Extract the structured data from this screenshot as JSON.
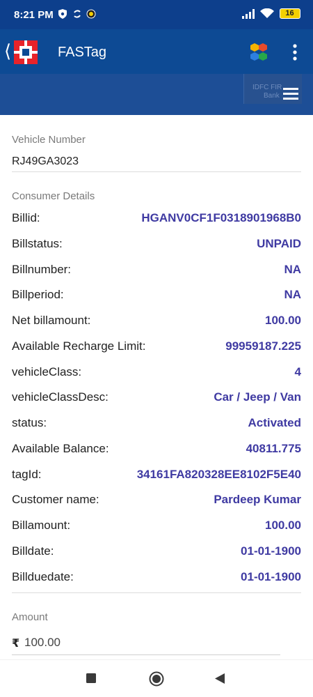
{
  "status_bar": {
    "time": "8:21 PM",
    "battery": "16"
  },
  "app_bar": {
    "title": "FASTag"
  },
  "banner": {
    "bank_text_line1": "IDFC FIR",
    "bank_text_line2": "Bank"
  },
  "vehicle": {
    "label": "Vehicle Number",
    "value": "RJ49GA3023"
  },
  "consumer": {
    "section_label": "Consumer Details",
    "rows": [
      {
        "key": "Billid:",
        "value": "HGANV0CF1F0318901968B0"
      },
      {
        "key": "Billstatus:",
        "value": "UNPAID"
      },
      {
        "key": "Billnumber:",
        "value": "NA"
      },
      {
        "key": "Billperiod:",
        "value": "NA"
      },
      {
        "key": "Net billamount:",
        "value": "100.00"
      },
      {
        "key": "Available Recharge Limit:",
        "value": "99959187.225"
      },
      {
        "key": "vehicleClass:",
        "value": "4"
      },
      {
        "key": "vehicleClassDesc:",
        "value": "Car / Jeep / Van"
      },
      {
        "key": "status:",
        "value": "Activated"
      },
      {
        "key": "Available Balance:",
        "value": "40811.775"
      },
      {
        "key": "tagId:",
        "value": "34161FA820328EE8102F5E40"
      },
      {
        "key": "Customer name:",
        "value": "Pardeep Kumar"
      },
      {
        "key": "Billamount:",
        "value": "100.00"
      },
      {
        "key": "Billdate:",
        "value": "01-01-1900"
      },
      {
        "key": "Billduedate:",
        "value": "01-01-1900"
      }
    ]
  },
  "amount": {
    "label": "Amount",
    "currency": "₹",
    "value": "100.00"
  },
  "colors": {
    "header_bg": "#0d4a94",
    "value_text": "#3f3aa2",
    "banner_bg": "#1d4e96"
  }
}
